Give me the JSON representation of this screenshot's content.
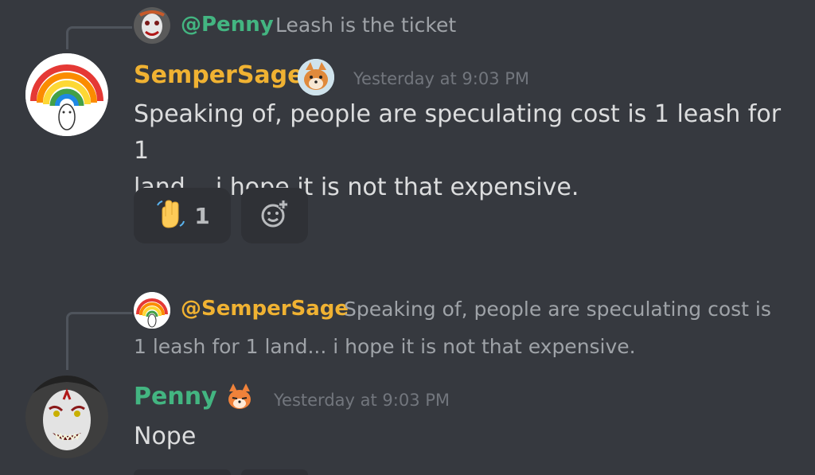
{
  "reply1": {
    "mention": "@Penny",
    "text": "Leash is the ticket"
  },
  "msg1": {
    "username": "SemperSage",
    "timestamp": "Yesterday at 9:03 PM",
    "line1": "Speaking of, people are speculating cost is 1 leash for 1",
    "line2": "land... i hope it is not that expensive.",
    "reaction": {
      "emoji": "wave-emoji",
      "count": "1"
    }
  },
  "reply2": {
    "mention": "@SemperSage",
    "line1": "Speaking of, people are speculating cost is",
    "line2": "1 leash for 1 land... i hope it is not that expensive."
  },
  "msg2": {
    "username": "Penny",
    "timestamp": "Yesterday at 9:03 PM",
    "text": "Nope"
  },
  "colors": {
    "background": "#36393f",
    "sempersage_name": "#f0b232",
    "penny_name": "#43b581"
  }
}
